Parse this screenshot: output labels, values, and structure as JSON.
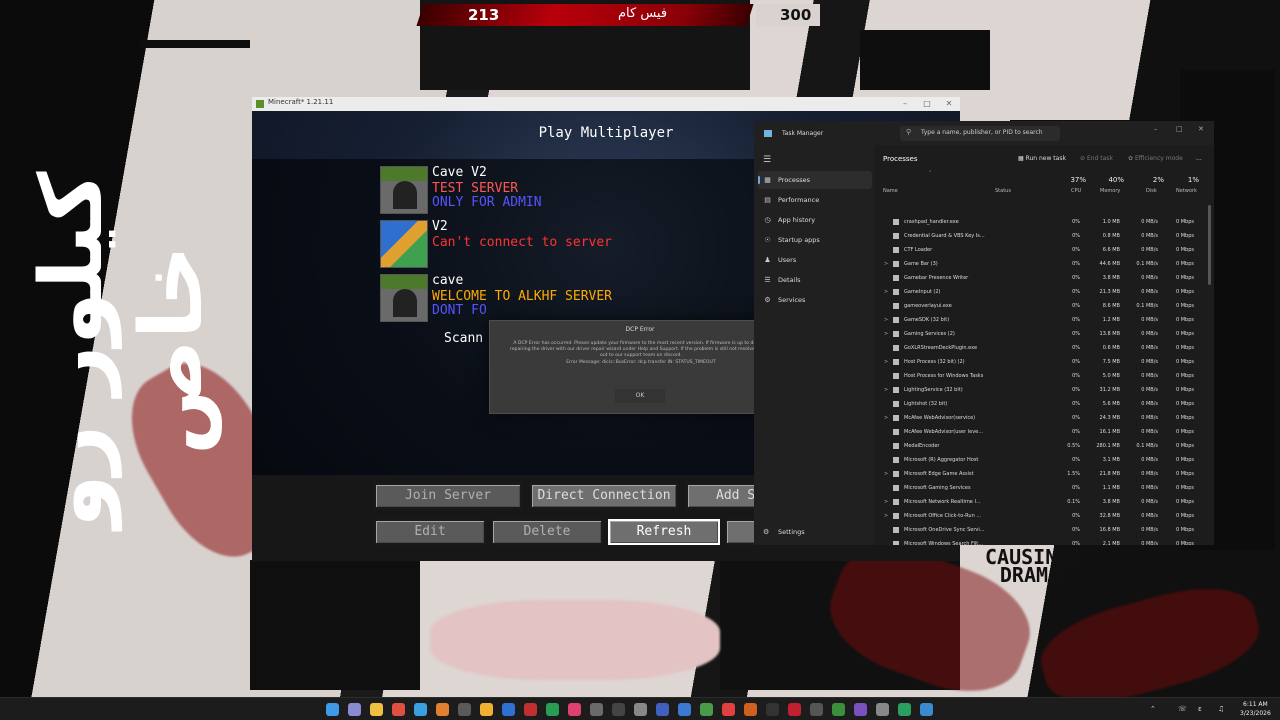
{
  "overlay": {
    "score_left": "213",
    "score_title": "فيس كام",
    "score_right": "300",
    "side_banner": "كيلور رو خاص",
    "drama_text": "CAUSINGA DRAMA"
  },
  "minecraft": {
    "window_title": "Minecraft* 1.21.11",
    "heading": "Play Multiplayer",
    "servers": [
      {
        "name": "Cave V2",
        "line1": "TEST SERVER",
        "line2": "ONLY FOR ADMIN",
        "line1_color": "#ff5555",
        "line2_color": "#5555ff"
      },
      {
        "name": "V2",
        "line1": "Can't connect to server",
        "line2": "",
        "line1_color": "#ff3333",
        "line2_color": ""
      },
      {
        "name": "cave",
        "line1": "WELCOME TO ALKHF SERVER",
        "line2": "DONT FO",
        "line1_color": "#ffaa00",
        "line2_color": "#5555ff"
      }
    ],
    "scan_text": "Scann",
    "buttons": {
      "join": "Join Server",
      "direct": "Direct Connection",
      "add": "Add S",
      "edit": "Edit",
      "delete": "Delete",
      "refresh": "Refresh"
    }
  },
  "dialog": {
    "title": "DCP Error",
    "message": "A DCP Error has occurred. Please update your firmware to the most recent version. If firmware is up to date try repairing the driver with our driver repair wizard under Help and Support. If the problem is still not resolved reach out to our support team on discord.",
    "error": "Error Message: dicis::BusError: dcp transfer IN: STATUS_TIMEOUT",
    "ok": "OK"
  },
  "task_manager": {
    "title": "Task Manager",
    "search_placeholder": "Type a name, publisher, or PID to search",
    "nav": [
      "Processes",
      "Performance",
      "App history",
      "Startup apps",
      "Users",
      "Details",
      "Services"
    ],
    "settings": "Settings",
    "page_title": "Processes",
    "toolbar": {
      "run": "Run new task",
      "end": "End task",
      "efficiency": "Efficiency mode",
      "more": "..."
    },
    "columns": {
      "name": "Name",
      "status": "Status",
      "cpu": "CPU",
      "memory": "Memory",
      "disk": "Disk",
      "network": "Network"
    },
    "totals": {
      "cpu": "37%",
      "memory": "40%",
      "disk": "2%",
      "network": "1%"
    },
    "rows": [
      {
        "exp": "",
        "name": "crashpad_handler.exe",
        "cpu": "0%",
        "mem": "1.0 MB",
        "disk": "0 MB/s",
        "net": "0 Mbps"
      },
      {
        "exp": "",
        "name": "Credential Guard & VBS Key Is...",
        "cpu": "0%",
        "mem": "0.8 MB",
        "disk": "0 MB/s",
        "net": "0 Mbps"
      },
      {
        "exp": "",
        "name": "CTF Loader",
        "cpu": "0%",
        "mem": "6.6 MB",
        "disk": "0 MB/s",
        "net": "0 Mbps"
      },
      {
        "exp": ">",
        "name": "Game Bar (3)",
        "cpu": "0%",
        "mem": "44.6 MB",
        "disk": "0.1 MB/s",
        "net": "0 Mbps"
      },
      {
        "exp": "",
        "name": "Gamebar Presence Writer",
        "cpu": "0%",
        "mem": "3.8 MB",
        "disk": "0 MB/s",
        "net": "0 Mbps"
      },
      {
        "exp": ">",
        "name": "GameInput (2)",
        "cpu": "0%",
        "mem": "21.3 MB",
        "disk": "0 MB/s",
        "net": "0 Mbps"
      },
      {
        "exp": "",
        "name": "gameoverlayui.exe",
        "cpu": "0%",
        "mem": "8.6 MB",
        "disk": "0.1 MB/s",
        "net": "0 Mbps"
      },
      {
        "exp": ">",
        "name": "GameSDK (32 bit)",
        "cpu": "0%",
        "mem": "1.2 MB",
        "disk": "0 MB/s",
        "net": "0 Mbps"
      },
      {
        "exp": ">",
        "name": "Gaming Services (2)",
        "cpu": "0%",
        "mem": "13.8 MB",
        "disk": "0 MB/s",
        "net": "0 Mbps"
      },
      {
        "exp": "",
        "name": "GoXLRStreamDeckPlugin.exe",
        "cpu": "0%",
        "mem": "0.6 MB",
        "disk": "0 MB/s",
        "net": "0 Mbps"
      },
      {
        "exp": ">",
        "name": "Host Process (32 bit) (2)",
        "cpu": "0%",
        "mem": "7.5 MB",
        "disk": "0 MB/s",
        "net": "0 Mbps"
      },
      {
        "exp": "",
        "name": "Host Process for Windows Tasks",
        "cpu": "0%",
        "mem": "5.0 MB",
        "disk": "0 MB/s",
        "net": "0 Mbps"
      },
      {
        "exp": ">",
        "name": "LightingService (32 bit)",
        "cpu": "0%",
        "mem": "31.2 MB",
        "disk": "0 MB/s",
        "net": "0 Mbps"
      },
      {
        "exp": "",
        "name": "Lightshot (32 bit)",
        "cpu": "0%",
        "mem": "5.6 MB",
        "disk": "0 MB/s",
        "net": "0 Mbps"
      },
      {
        "exp": ">",
        "name": "McAfee WebAdvisor(service)",
        "cpu": "0%",
        "mem": "24.3 MB",
        "disk": "0 MB/s",
        "net": "0 Mbps"
      },
      {
        "exp": "",
        "name": "McAfee WebAdvisor(user leve...",
        "cpu": "0%",
        "mem": "16.1 MB",
        "disk": "0 MB/s",
        "net": "0 Mbps"
      },
      {
        "exp": "",
        "name": "MedalEncoder",
        "cpu": "0.5%",
        "mem": "280.1 MB",
        "disk": "0.1 MB/s",
        "net": "0 Mbps"
      },
      {
        "exp": "",
        "name": "Microsoft (R) Aggregator Host",
        "cpu": "0%",
        "mem": "3.1 MB",
        "disk": "0 MB/s",
        "net": "0 Mbps"
      },
      {
        "exp": ">",
        "name": "Microsoft Edge Game Assist",
        "cpu": "1.5%",
        "mem": "21.8 MB",
        "disk": "0 MB/s",
        "net": "0 Mbps"
      },
      {
        "exp": "",
        "name": "Microsoft Gaming Services",
        "cpu": "0%",
        "mem": "1.1 MB",
        "disk": "0 MB/s",
        "net": "0 Mbps"
      },
      {
        "exp": ">",
        "name": "Microsoft Network Realtime I...",
        "cpu": "0.1%",
        "mem": "3.8 MB",
        "disk": "0 MB/s",
        "net": "0 Mbps"
      },
      {
        "exp": ">",
        "name": "Microsoft Office Click-to-Run ...",
        "cpu": "0%",
        "mem": "32.8 MB",
        "disk": "0 MB/s",
        "net": "0 Mbps"
      },
      {
        "exp": "",
        "name": "Microsoft OneDrive Sync Servi...",
        "cpu": "0%",
        "mem": "16.8 MB",
        "disk": "0 MB/s",
        "net": "0 Mbps"
      },
      {
        "exp": "",
        "name": "Microsoft Windows Search Filt...",
        "cpu": "0%",
        "mem": "2.1 MB",
        "disk": "0 MB/s",
        "net": "0 Mbps"
      }
    ]
  },
  "taskbar": {
    "time": "6:11 AM",
    "date": "3/23/2026"
  }
}
